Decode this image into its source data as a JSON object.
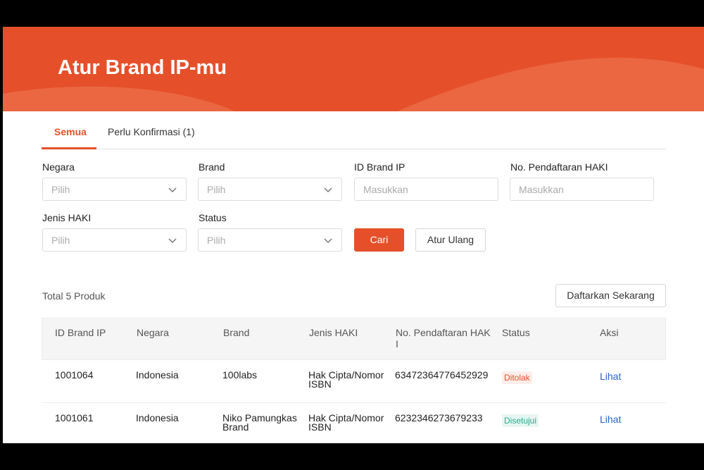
{
  "banner": {
    "title": "Atur Brand IP-mu"
  },
  "tabs": [
    {
      "label": "Semua"
    },
    {
      "label": "Perlu Konfirmasi (1)"
    }
  ],
  "filters": {
    "negara": {
      "label": "Negara",
      "placeholder": "Pilih"
    },
    "brand": {
      "label": "Brand",
      "placeholder": "Pilih"
    },
    "id_brand_ip": {
      "label": "ID Brand IP",
      "placeholder": "Masukkan"
    },
    "no_pendaftaran": {
      "label": "No. Pendaftaran HAKI",
      "placeholder": "Masukkan"
    },
    "jenis_haki": {
      "label": "Jenis HAKI",
      "placeholder": "Pilih"
    },
    "status": {
      "label": "Status",
      "placeholder": "Pilih"
    },
    "search_button": "Cari",
    "reset_button": "Atur Ulang"
  },
  "list": {
    "total": "Total 5 Produk",
    "register_button": "Daftarkan Sekarang"
  },
  "table": {
    "headers": {
      "id": "ID Brand IP",
      "negara": "Negara",
      "brand": "Brand",
      "jenis": "Jenis HAKI",
      "no_1": "No. Pendaftaran HAK",
      "no_2": "I",
      "status": "Status",
      "aksi": "Aksi"
    },
    "rows": [
      {
        "id": "1001064",
        "negara": "Indonesia",
        "brand_1": "100labs",
        "brand_2": "",
        "jenis_1": "Hak Cipta/Nomor",
        "jenis_2": "ISBN",
        "no": "63472364776452929",
        "status": "Ditolak",
        "status_color": "#e5502a",
        "action": "Lihat"
      },
      {
        "id": "1001061",
        "negara": "Indonesia",
        "brand_1": "Niko Pamungkas",
        "brand_2": "Brand",
        "jenis_1": "Hak Cipta/Nomor",
        "jenis_2": "ISBN",
        "no": "6232346273679233",
        "status": "Disetujui",
        "status_color": "#2ba88a",
        "action": "Lihat"
      }
    ]
  },
  "colors": {
    "accent": "#e5502a",
    "link": "#2a62c9"
  },
  "icons": {
    "dropdown": "chevron-down-icon"
  }
}
